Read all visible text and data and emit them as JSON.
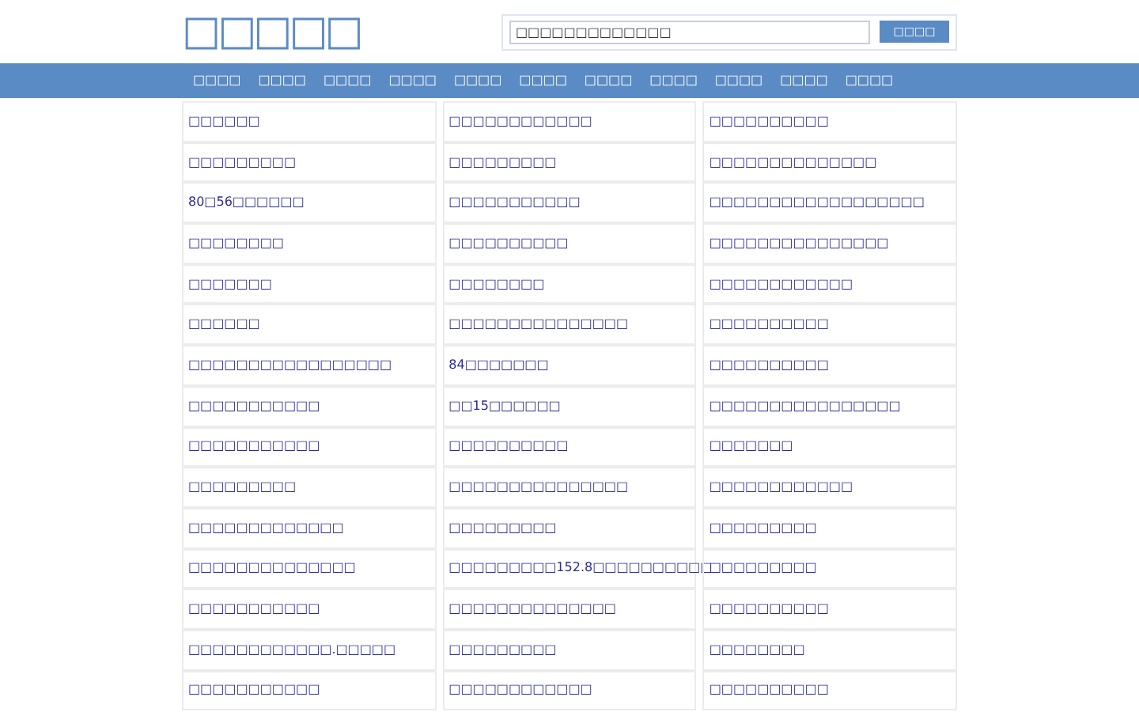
{
  "logo": "□□□□□",
  "search": {
    "value": "□□□□□□□□□□□□□",
    "button": "□□□□"
  },
  "nav": [
    "□□□□",
    "□□□□",
    "□□□□",
    "□□□□",
    "□□□□",
    "□□□□",
    "□□□□",
    "□□□□",
    "□□□□",
    "□□□□",
    "□□□□"
  ],
  "links": [
    [
      "□□□□□□",
      "□□□□□□□□□□□□",
      "□□□□□□□□□□"
    ],
    [
      "□□□□□□□□□",
      "□□□□□□□□□",
      "□□□□□□□□□□□□□□"
    ],
    [
      "80□56□□□□□□",
      "□□□□□□□□□□□",
      "□□□□□□□□□□□□□□□□□□"
    ],
    [
      "□□□□□□□□",
      "□□□□□□□□□□",
      "□□□□□□□□□□□□□□□"
    ],
    [
      "□□□□□□□",
      "□□□□□□□□",
      "□□□□□□□□□□□□"
    ],
    [
      "□□□□□□",
      "□□□□□□□□□□□□□□□",
      "□□□□□□□□□□"
    ],
    [
      "□□□□□□□□□□□□□□□□□",
      "84□□□□□□□",
      "□□□□□□□□□□"
    ],
    [
      "□□□□□□□□□□□",
      "□□15□□□□□□",
      "□□□□□□□□□□□□□□□□"
    ],
    [
      "□□□□□□□□□□□",
      "□□□□□□□□□□",
      "□□□□□□□"
    ],
    [
      "□□□□□□□□□",
      "□□□□□□□□□□□□□□□",
      "□□□□□□□□□□□□"
    ],
    [
      "□□□□□□□□□□□□□",
      "□□□□□□□□□",
      "□□□□□□□□□"
    ],
    [
      "□□□□□□□□□□□□□□",
      "□□□□□□□□□152.8□□□□□□□□□□",
      "□□□□□□□□□"
    ],
    [
      "□□□□□□□□□□□",
      "□□□□□□□□□□□□□□",
      "□□□□□□□□□□"
    ],
    [
      "□□□□□□□□□□□□.□□□□□",
      "□□□□□□□□□",
      "□□□□□□□□"
    ],
    [
      "□□□□□□□□□□□",
      "□□□□□□□□□□□□",
      "□□□□□□□□□□"
    ]
  ]
}
